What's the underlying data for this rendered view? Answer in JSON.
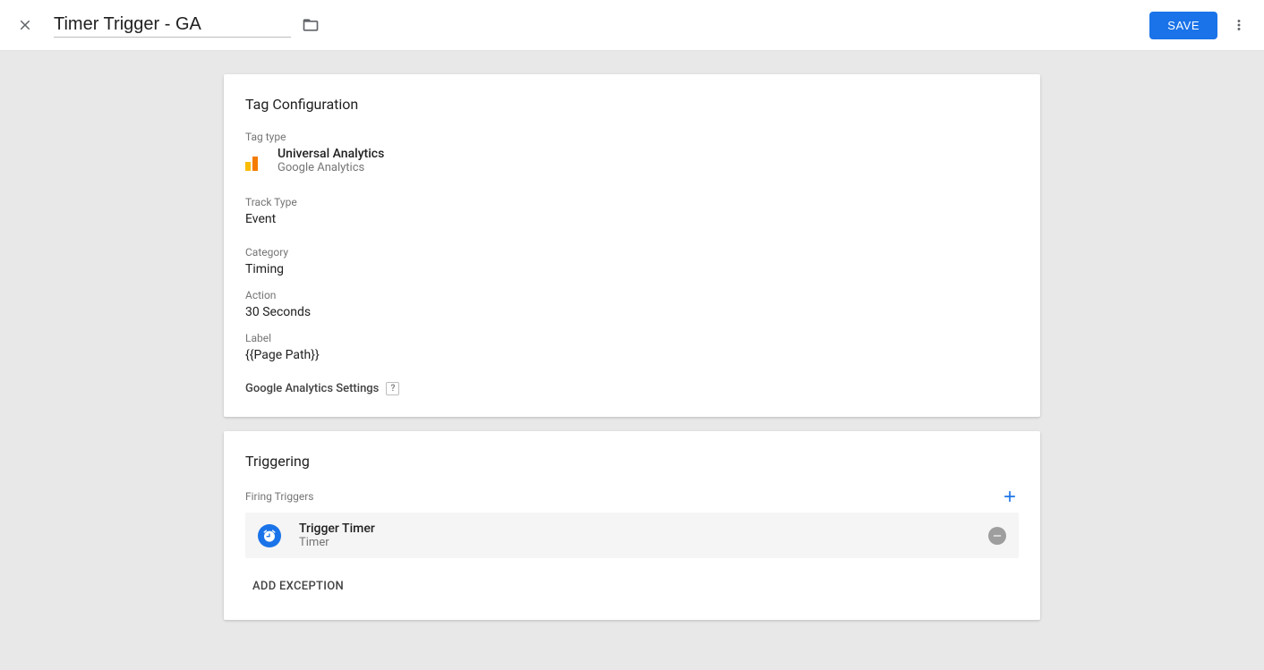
{
  "header": {
    "title": "Timer Trigger - GA",
    "save_label": "SAVE"
  },
  "tagConfig": {
    "title": "Tag Configuration",
    "tagTypeLabel": "Tag type",
    "tagTypeName": "Universal Analytics",
    "tagTypeSub": "Google Analytics",
    "trackTypeLabel": "Track Type",
    "trackTypeValue": "Event",
    "categoryLabel": "Category",
    "categoryValue": "Timing",
    "actionLabel": "Action",
    "actionValue": "30 Seconds",
    "labelLabel": "Label",
    "labelValue": "{{Page Path}}",
    "gaSettingsLabel": "Google Analytics Settings",
    "helpGlyph": "?"
  },
  "triggering": {
    "title": "Triggering",
    "firingLabel": "Firing Triggers",
    "trigger": {
      "name": "Trigger Timer",
      "type": "Timer"
    },
    "addException": "ADD EXCEPTION"
  }
}
